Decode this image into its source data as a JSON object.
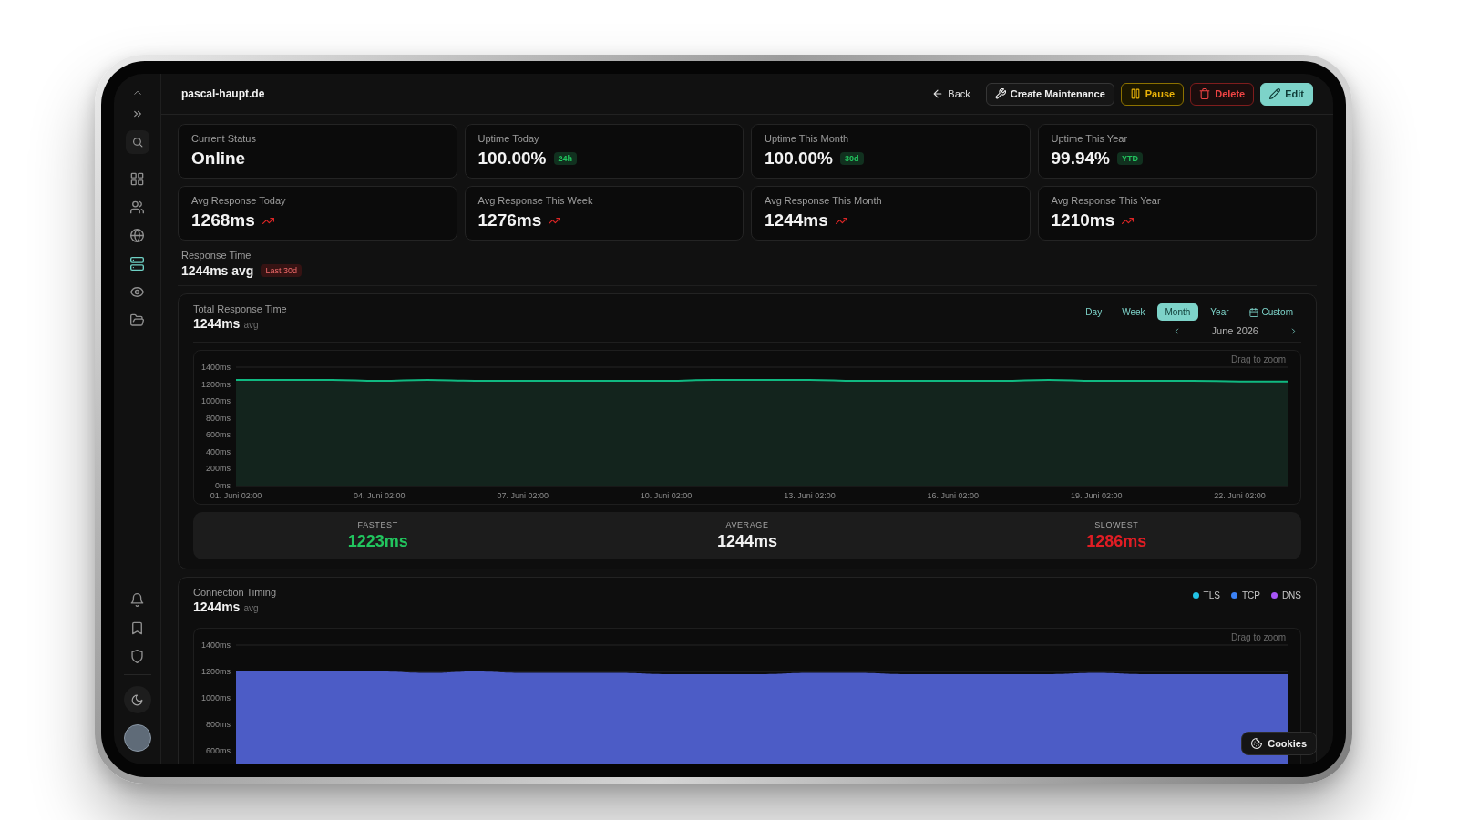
{
  "sidebar": {
    "nav_items": [
      {
        "kind": "grid",
        "selected": false
      },
      {
        "kind": "users",
        "selected": false
      },
      {
        "kind": "globe",
        "selected": false
      },
      {
        "kind": "server",
        "selected": true
      },
      {
        "kind": "eye",
        "selected": false
      },
      {
        "kind": "folder",
        "selected": false
      }
    ],
    "bottom_items": [
      {
        "kind": "bell"
      },
      {
        "kind": "bookmark"
      },
      {
        "kind": "shield"
      }
    ]
  },
  "header": {
    "title": "pascal-haupt.de",
    "actions": [
      {
        "label": "Back",
        "kind": "back"
      },
      {
        "label": "Create Maintenance",
        "kind": "maintenance"
      },
      {
        "label": "Pause",
        "kind": "pause"
      },
      {
        "label": "Delete",
        "kind": "delete"
      },
      {
        "label": "Edit",
        "kind": "edit"
      }
    ]
  },
  "stats": [
    {
      "label": "Current Status",
      "value": "Online"
    },
    {
      "label": "Uptime Today",
      "value": "100.00%",
      "badge": "24h"
    },
    {
      "label": "Uptime This Month",
      "value": "100.00%",
      "badge": "30d"
    },
    {
      "label": "Uptime This Year",
      "value": "99.94%",
      "badge": "YTD"
    },
    {
      "label": "Avg Response Today",
      "value": "1268ms",
      "trend_up": true
    },
    {
      "label": "Avg Response This Week",
      "value": "1276ms",
      "trend_up": true
    },
    {
      "label": "Avg Response This Month",
      "value": "1244ms",
      "trend_up": true
    },
    {
      "label": "Avg Response This Year",
      "value": "1210ms",
      "trend_up": true
    }
  ],
  "response_time": {
    "label": "Response Time",
    "value": "1244ms avg",
    "badge": "Last 30d"
  },
  "total_response_time": {
    "label": "Total Response Time",
    "value": "1244ms",
    "unit": "avg",
    "periods": [
      {
        "label": "Day",
        "kind": "preset",
        "selected": false
      },
      {
        "label": "Week",
        "kind": "preset",
        "selected": false
      },
      {
        "label": "Month",
        "kind": "preset",
        "selected": true
      },
      {
        "label": "Year",
        "kind": "preset",
        "selected": false
      },
      {
        "label": "Custom",
        "kind": "custom",
        "selected": false
      }
    ],
    "period_nav": {
      "label": "June 2026"
    },
    "hint": "Drag to zoom",
    "chart_data": {
      "type": "area",
      "categories": [
        "01. Juni 02:00",
        null,
        null,
        "04. Juni 02:00",
        null,
        null,
        "07. Juni 02:00",
        null,
        null,
        "10. Juni 02:00",
        null,
        null,
        "13. Juni 02:00",
        null,
        null,
        "16. Juni 02:00",
        null,
        null,
        "19. Juni 02:00",
        null,
        null,
        "22. Juni 02:00",
        null
      ],
      "values": [
        1250,
        1250,
        1250,
        1240,
        1250,
        1240,
        1240,
        1240,
        1240,
        1240,
        1250,
        1250,
        1250,
        1240,
        1240,
        1240,
        1240,
        1250,
        1240,
        1240,
        1240,
        1230,
        1230
      ],
      "ylim": [
        0,
        1400
      ],
      "yticks": [
        {
          "value": 0,
          "label": "0ms"
        },
        {
          "value": 200,
          "label": "200ms"
        },
        {
          "value": 400,
          "label": "400ms"
        },
        {
          "value": 600,
          "label": "600ms"
        },
        {
          "value": 800,
          "label": "800ms"
        },
        {
          "value": 1000,
          "label": "1000ms"
        },
        {
          "value": 1200,
          "label": "1200ms"
        },
        {
          "value": 1400,
          "label": "1400ms"
        }
      ]
    },
    "summary": [
      {
        "label": "FASTEST",
        "value": "1223ms",
        "kind": "fastest"
      },
      {
        "label": "AVERAGE",
        "value": "1244ms",
        "kind": "average"
      },
      {
        "label": "SLOWEST",
        "value": "1286ms",
        "kind": "slowest"
      }
    ]
  },
  "connection_timing": {
    "label": "Connection Timing",
    "value": "1244ms",
    "unit": "avg",
    "legend": [
      {
        "name": "TLS",
        "color": "#22c3e6"
      },
      {
        "name": "TCP",
        "color": "#3b82f6"
      },
      {
        "name": "DNS",
        "color": "#a855f7"
      }
    ],
    "hint": "Drag to zoom",
    "chart_data": {
      "type": "area",
      "categories": [
        null,
        null,
        null,
        null,
        null,
        null,
        null,
        null,
        null,
        null,
        null,
        null,
        null,
        null,
        null,
        null,
        null,
        null,
        null,
        null,
        null,
        null,
        null
      ],
      "values": [
        1200,
        1200,
        1200,
        1200,
        1190,
        1200,
        1190,
        1190,
        1190,
        1180,
        1180,
        1180,
        1190,
        1190,
        1180,
        1180,
        1180,
        1180,
        1190,
        1180,
        1180,
        1180,
        1180
      ],
      "ylim": [
        500,
        1400
      ],
      "yticks": [
        {
          "value": 600,
          "label": "600ms"
        },
        {
          "value": 800,
          "label": "800ms"
        },
        {
          "value": 1000,
          "label": "1000ms"
        },
        {
          "value": 1200,
          "label": "1200ms"
        },
        {
          "value": 1400,
          "label": "1400ms"
        }
      ]
    }
  },
  "cookies_button": {
    "label": "Cookies"
  }
}
